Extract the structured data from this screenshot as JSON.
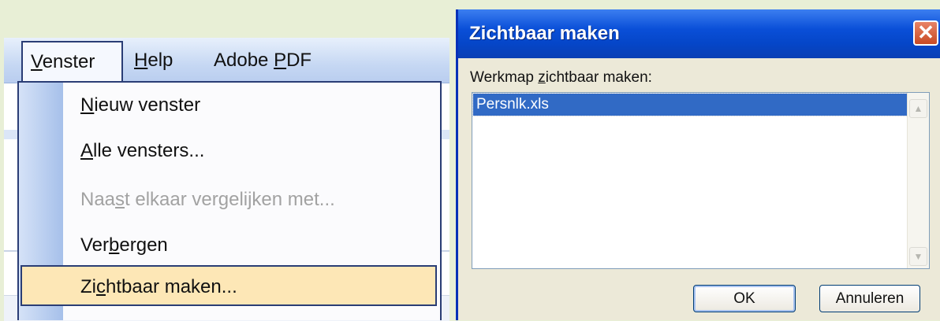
{
  "menubar": {
    "items": [
      {
        "prefix": "",
        "accel": "V",
        "suffix": "enster"
      },
      {
        "prefix": "",
        "accel": "H",
        "suffix": "elp"
      },
      {
        "prefix": "Adobe ",
        "accel": "P",
        "suffix": "DF"
      }
    ]
  },
  "dropdown": {
    "items": [
      {
        "prefix": "",
        "accel": "N",
        "suffix": "ieuw venster",
        "enabled": true
      },
      {
        "prefix": "",
        "accel": "A",
        "suffix": "lle vensters...",
        "enabled": true
      },
      {
        "prefix": "Naa",
        "accel": "s",
        "suffix": "t elkaar vergelijken met...",
        "enabled": false
      },
      {
        "prefix": "Ver",
        "accel": "b",
        "suffix": "ergen",
        "enabled": true
      },
      {
        "prefix": "Zi",
        "accel": "c",
        "suffix": "htbaar maken...",
        "enabled": true,
        "highlighted": true
      }
    ]
  },
  "dialog": {
    "title": "Zichtbaar maken",
    "close_symbol": "✕",
    "label_prefix": "Werkmap ",
    "label_accel": "z",
    "label_suffix": "ichtbaar maken:",
    "list_items": [
      "Persnlk.xls"
    ],
    "ok_label": "OK",
    "cancel_label": "Annuleren",
    "scroll_up_symbol": "▲",
    "scroll_down_symbol": "▼"
  },
  "colors": {
    "selection": "#316ac5",
    "menu_highlight": "#fde7b6",
    "titlebar": "#0546c8"
  }
}
